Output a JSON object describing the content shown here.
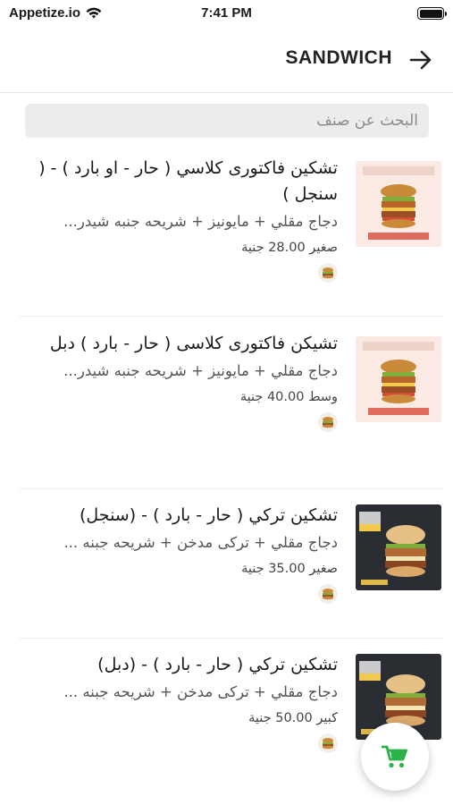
{
  "status_bar": {
    "carrier": "Appetize.io",
    "time": "7:41 PM"
  },
  "header": {
    "title": "SANDWICH",
    "back_icon": "arrow-right-icon"
  },
  "search": {
    "placeholder": "البحث عن صنف",
    "value": ""
  },
  "products": [
    {
      "title": "تشكين فاكتورى كلاسي ( حار - او بارد ) - ( سنجل )",
      "description": "دجاج مقلي + مايونيز + شريحه جنبه شيدر...",
      "price": "صغير 28.00 جنية"
    },
    {
      "title": "تشيكن فاكتورى كلاسى ( حار - بارد ) دبل",
      "description": "دجاج مقلي + مايونيز + شريحه جنبه شيدر...",
      "price": "وسط 40.00 جنية"
    },
    {
      "title": "تشكين تركي ( حار - بارد ) - (سنجل)",
      "description": "دجاج مقلي + تركى مدخن + شريحه جبنه ...",
      "price": "صغير 35.00 جنية"
    },
    {
      "title": "تشكين تركي ( حار - بارد ) - (دبل)",
      "description": "دجاج مقلي + تركى مدخن + شريحه جبنه ...",
      "price": "كبير 50.00 جنية"
    }
  ],
  "colors": {
    "accent": "#2bb34a",
    "search_bg": "#ececec",
    "divider": "#ececec"
  },
  "cart": {
    "icon": "cart-icon"
  }
}
